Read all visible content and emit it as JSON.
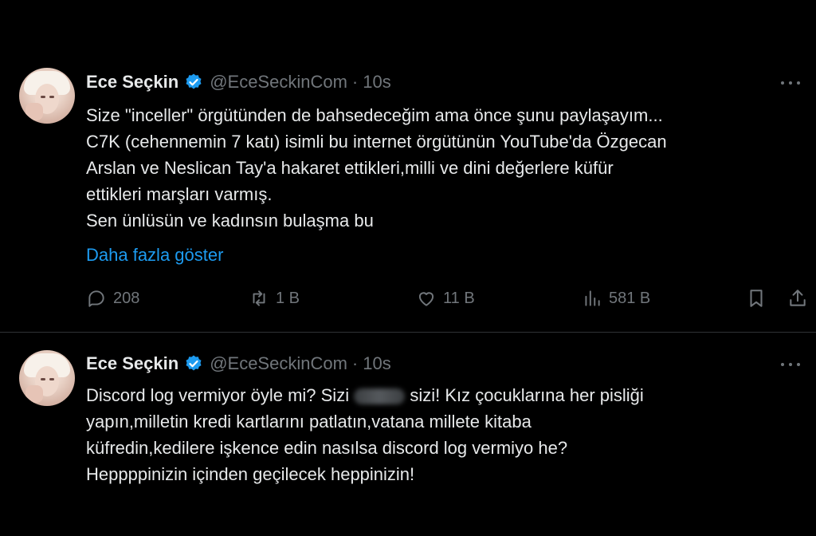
{
  "tweets": [
    {
      "author_name": "Ece Seçkin",
      "handle": "@EceSeckinCom",
      "time": "10s",
      "lines": [
        "Size \"inceller\" örgütünden de bahsedeceğim ama önce şunu paylaşayım...",
        "C7K (cehennemin 7 katı) isimli bu internet örgütünün YouTube'da Özgecan",
        "Arslan ve Neslican Tay'a hakaret ettikleri,milli ve dini değerlere küfür",
        "ettikleri marşları varmış.",
        "Sen ünlüsün ve kadınsın bulaşma bu"
      ],
      "show_more": "Daha fazla göster",
      "stats": {
        "replies": "208",
        "reposts": "1 B",
        "likes": "11 B",
        "views": "581 B"
      }
    },
    {
      "author_name": "Ece Seçkin",
      "handle": "@EceSeckinCom",
      "time": "10s",
      "line1_before": "Discord log vermiyor öyle mi? Sizi",
      "line1_after": "sizi! Kız çocuklarına her pisliği",
      "lines_rest": [
        "yapın,milletin kredi kartlarını patlatın,vatana millete kitaba",
        "küfredin,kedilere işkence edin nasılsa discord log vermiyo he?",
        "Heppppinizin içinden geçilecek heppinizin!"
      ]
    }
  ],
  "separator": "·",
  "colors": {
    "background": "#000000",
    "text": "#e7e9ea",
    "muted": "#71767b",
    "accent": "#1d9bf0"
  },
  "icons": [
    "verified-badge-icon",
    "more-icon",
    "reply-icon",
    "repost-icon",
    "like-icon",
    "views-icon",
    "bookmark-icon",
    "share-icon"
  ]
}
